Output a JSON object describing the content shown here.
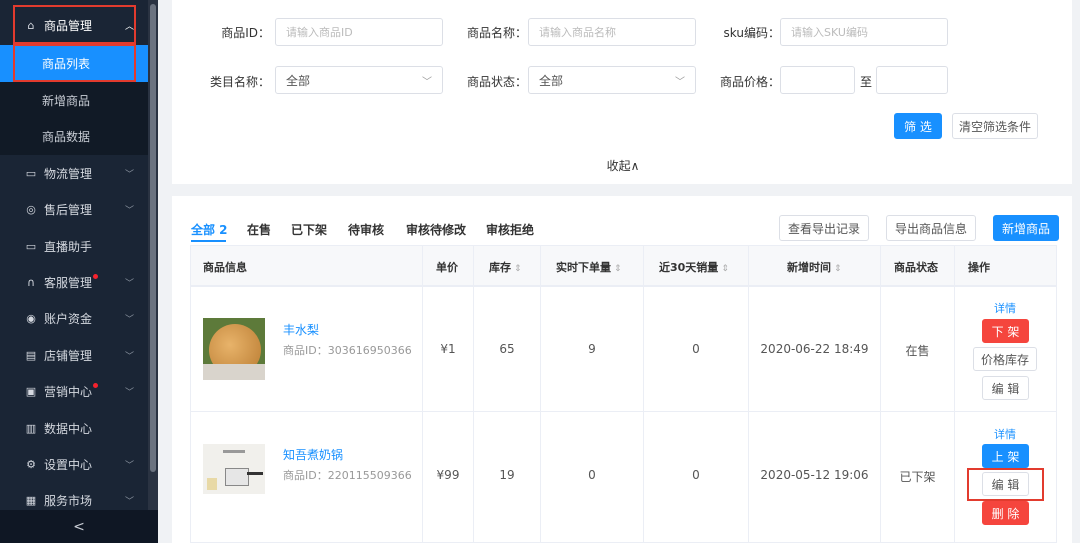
{
  "sidebar": {
    "items": [
      {
        "label": "商品管理",
        "icon": "shop-bag-icon"
      },
      {
        "label": "商品列表"
      },
      {
        "label": "新增商品"
      },
      {
        "label": "商品数据"
      },
      {
        "label": "物流管理",
        "icon": "truck-icon"
      },
      {
        "label": "售后管理",
        "icon": "shield-icon"
      },
      {
        "label": "直播助手",
        "icon": "live-icon"
      },
      {
        "label": "客服管理",
        "icon": "headset-icon"
      },
      {
        "label": "账户资金",
        "icon": "money-icon"
      },
      {
        "label": "店铺管理",
        "icon": "store-icon"
      },
      {
        "label": "营销中心",
        "icon": "marketing-icon"
      },
      {
        "label": "数据中心",
        "icon": "chart-icon"
      },
      {
        "label": "设置中心",
        "icon": "settings-icon"
      },
      {
        "label": "服务市场",
        "icon": "grid-icon"
      }
    ],
    "collapse": "<"
  },
  "filters": {
    "product_id": {
      "label": "商品ID：",
      "placeholder": "请输入商品ID"
    },
    "product_name": {
      "label": "商品名称：",
      "placeholder": "请输入商品名称"
    },
    "sku": {
      "label": "sku编码：",
      "placeholder": "请输入SKU编码"
    },
    "category": {
      "label": "类目名称：",
      "value": "全部"
    },
    "status": {
      "label": "商品状态：",
      "value": "全部"
    },
    "price": {
      "label": "商品价格：",
      "to": "至"
    },
    "filter_btn": "筛 选",
    "clear_btn": "清空筛选条件",
    "collapse": "收起∧"
  },
  "tabs": [
    "全部 2",
    "在售",
    "已下架",
    "待审核",
    "审核待修改",
    "审核拒绝"
  ],
  "actions": {
    "export_log": "查看导出记录",
    "export": "导出商品信息",
    "add": "新增商品"
  },
  "table": {
    "headers": [
      "商品信息",
      "单价",
      "库存",
      "实时下单量",
      "近30天销量",
      "新增时间",
      "商品状态",
      "操作"
    ],
    "sort_icon": "⇕",
    "rows": [
      {
        "name": "丰水梨",
        "id": "商品ID：303616950366",
        "price": "¥1",
        "stock": "65",
        "orders": "9",
        "sales30": "0",
        "created": "2020-06-22 18:49",
        "status": "在售",
        "ops": {
          "detail": "详情",
          "toggle": "下 架",
          "price_stock": "价格库存",
          "edit": "编 辑"
        }
      },
      {
        "name": "知吾煮奶锅",
        "id": "商品ID：220115509366",
        "price": "¥99",
        "stock": "19",
        "orders": "0",
        "sales30": "0",
        "created": "2020-05-12 19:06",
        "status": "已下架",
        "ops": {
          "detail": "详情",
          "toggle": "上 架",
          "edit": "编 辑",
          "delete": "删 除"
        }
      }
    ]
  },
  "colors": {
    "accent": "#1890ff",
    "danger": "#f5453d",
    "sidebar": "#1a2535",
    "highlight": "#e23b2e"
  }
}
